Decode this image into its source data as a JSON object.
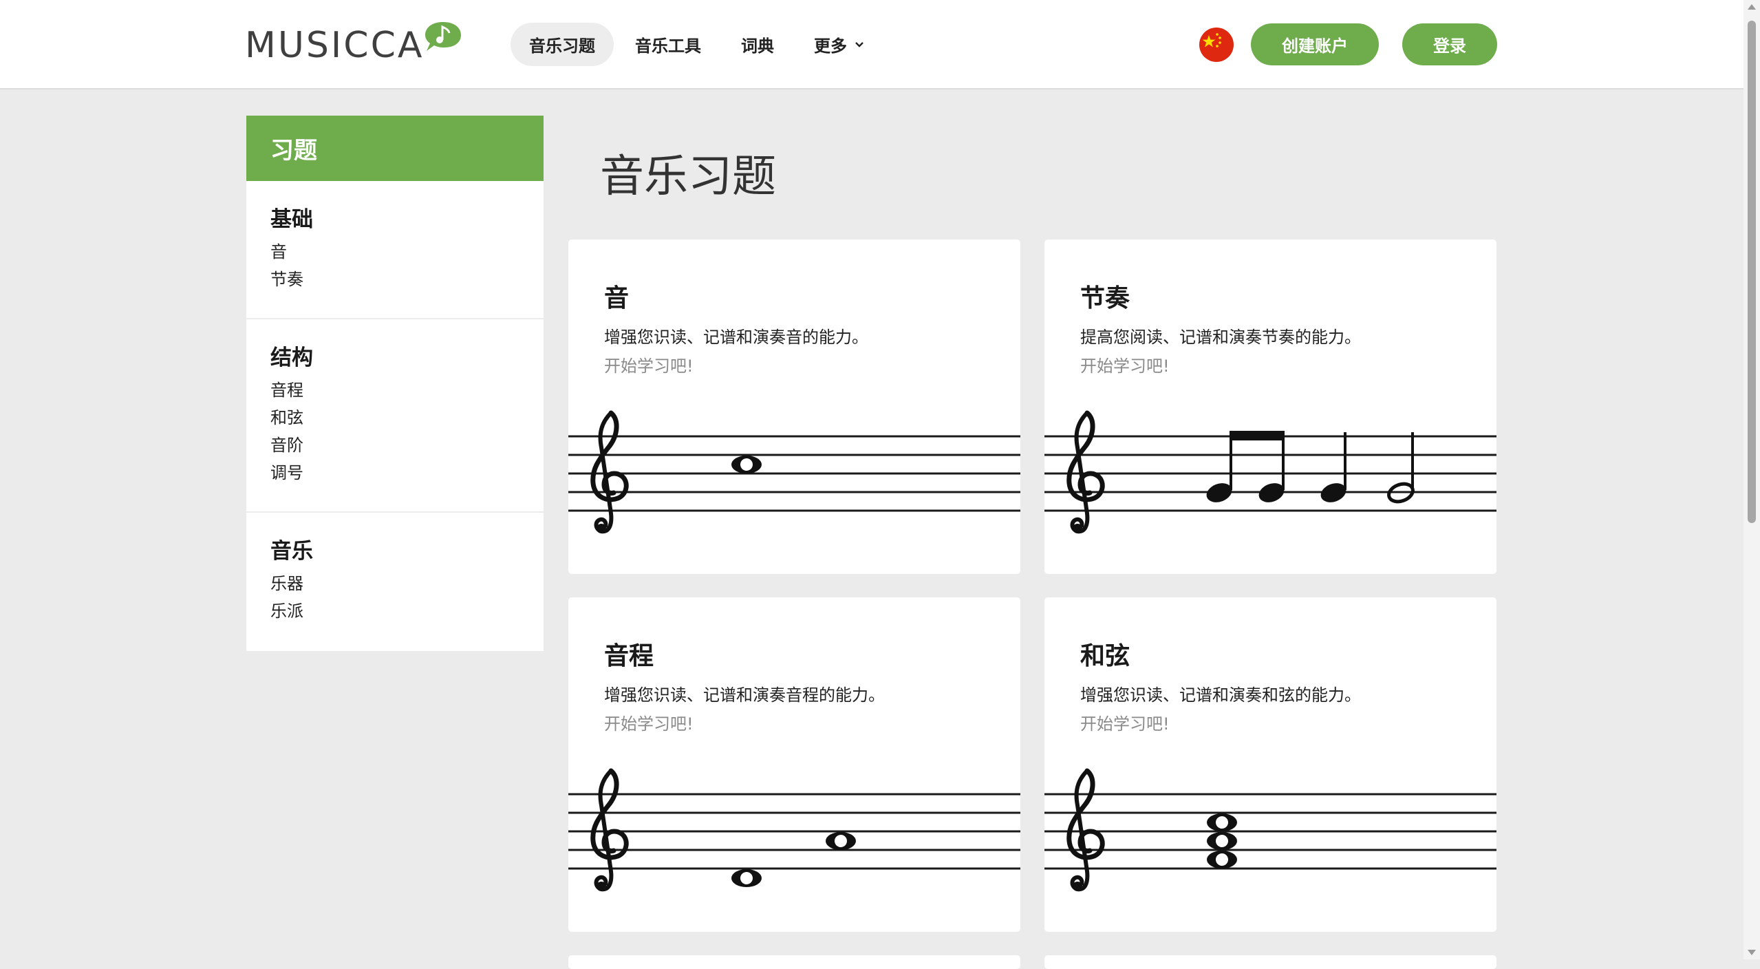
{
  "brand": {
    "logo_text": "MUSICCA",
    "accent": "#6eac4c"
  },
  "nav": {
    "items": [
      {
        "label": "音乐习题",
        "active": true
      },
      {
        "label": "音乐工具",
        "active": false
      },
      {
        "label": "词典",
        "active": false
      },
      {
        "label": "更多",
        "active": false
      }
    ],
    "language_flag": "china-flag-icon",
    "create_account": "创建账户",
    "login": "登录"
  },
  "sidebar": {
    "title": "习题",
    "groups": [
      {
        "title": "基础",
        "links": [
          "音",
          "节奏"
        ]
      },
      {
        "title": "结构",
        "links": [
          "音程",
          "和弦",
          "音阶",
          "调号"
        ]
      },
      {
        "title": "音乐",
        "links": [
          "乐器",
          "乐派"
        ]
      }
    ]
  },
  "main": {
    "title": "音乐习题",
    "cards": [
      {
        "title": "音",
        "desc": "增强您识读、记谱和演奏音的能力。",
        "cta": "开始学习吧!",
        "illustration": "whole-note-staff-icon"
      },
      {
        "title": "节奏",
        "desc": "提高您阅读、记谱和演奏节奏的能力。",
        "cta": "开始学习吧!",
        "illustration": "rhythm-notes-staff-icon"
      },
      {
        "title": "音程",
        "desc": "增强您识读、记谱和演奏音程的能力。",
        "cta": "开始学习吧!",
        "illustration": "interval-staff-icon"
      },
      {
        "title": "和弦",
        "desc": "增强您识读、记谱和演奏和弦的能力。",
        "cta": "开始学习吧!",
        "illustration": "chord-staff-icon"
      }
    ]
  }
}
